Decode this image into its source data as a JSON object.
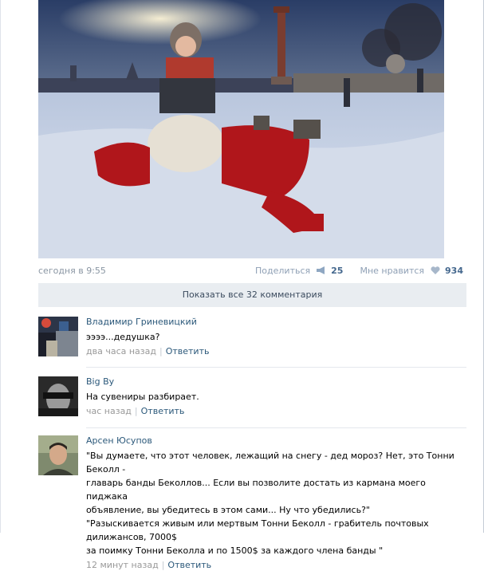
{
  "post": {
    "photo_alt_icon": "photo-image",
    "date": "сегодня в 9:55",
    "share_label": "Поделиться",
    "share_count": "25",
    "like_label": "Мне нравится",
    "like_count": "934"
  },
  "show_all_label": "Показать все 32 комментария",
  "comments": [
    {
      "author": "Владимир Гриневицкий",
      "text": "ээээ...дедушка?",
      "time": "два часа назад",
      "reply": "Ответить"
    },
    {
      "author": "Big By",
      "text": "На сувениры разбирает.",
      "time": "час назад",
      "reply": "Ответить"
    },
    {
      "author": "Арсен Юсупов",
      "text_lines": [
        "\"Вы думаете, что этот человек, лежащий на снегу - дед мороз? Нет, это Тонни Беколл -",
        "главарь банды Бекол­лов... Если вы позволите достать из кармана моего пиджака",
        "объявление, вы убедитесь в этом сами... Ну что убедились?\"",
        "\"Разыскивается живым или мертвым Тонни Беколл - грабитель почтовых дилижансов, 7000$",
        "за поимку Тонни Беколла и по 1500$ за каждого члена банды \""
      ],
      "time": "12 минут назад",
      "reply": "Ответить"
    }
  ],
  "colors": {
    "link": "#2b587a",
    "muted": "#8a96a3",
    "show_all_bg": "#e9edf1"
  }
}
